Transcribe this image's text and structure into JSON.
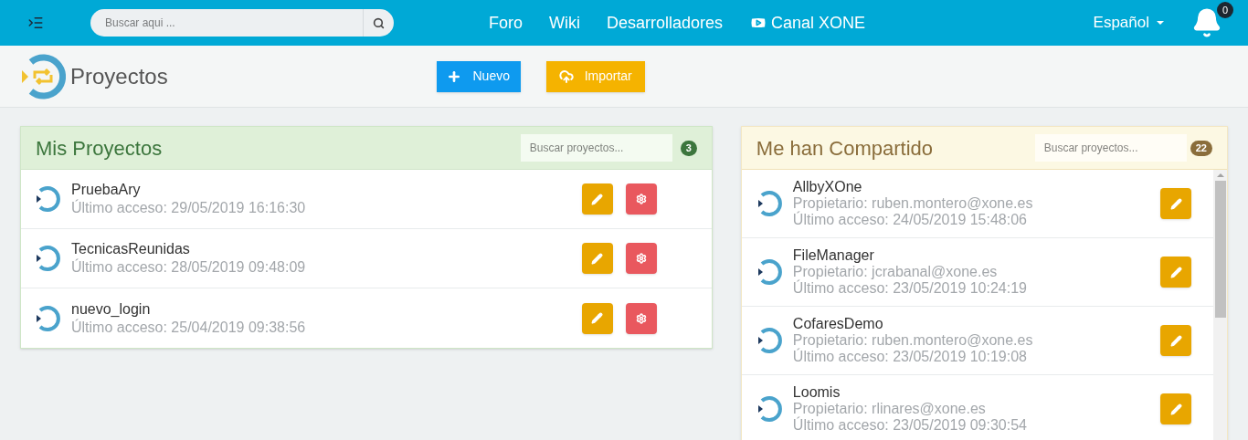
{
  "header": {
    "search": {
      "placeholder": "Buscar aqui ..."
    },
    "nav": [
      {
        "label": "Foro",
        "kind": "text"
      },
      {
        "label": "Wiki",
        "kind": "text"
      },
      {
        "label": "Desarrolladores",
        "kind": "text"
      },
      {
        "label": "Canal XONE",
        "kind": "video"
      }
    ],
    "language": "Español",
    "notifications": "0"
  },
  "page": {
    "title": "Proyectos",
    "actions": [
      {
        "label": "Nuevo",
        "kind": "new"
      },
      {
        "label": "Importar",
        "kind": "import"
      }
    ]
  },
  "my_projects": {
    "title": "Mis Proyectos",
    "search": {
      "placeholder": "Buscar proyectos..."
    },
    "count": "3",
    "items": [
      {
        "name": "PruebaAry",
        "access": "Último acceso: 29/05/2019 16:16:30"
      },
      {
        "name": "TecnicasReunidas",
        "access": "Último acceso: 28/05/2019 09:48:09"
      },
      {
        "name": "nuevo_login",
        "access": "Último acceso: 25/04/2019 09:38:56"
      }
    ]
  },
  "shared": {
    "title": "Me han Compartido",
    "search": {
      "placeholder": "Buscar proyectos..."
    },
    "count": "22",
    "items": [
      {
        "name": "AllbyXOne",
        "owner": "Propietario: ruben.montero@xone.es",
        "access": "Último acceso: 24/05/2019 15:48:06"
      },
      {
        "name": "FileManager",
        "owner": "Propietario: jcrabanal@xone.es",
        "access": "Último acceso: 23/05/2019 10:24:19"
      },
      {
        "name": "CofaresDemo",
        "owner": "Propietario: ruben.montero@xone.es",
        "access": "Último acceso: 23/05/2019 10:19:08"
      },
      {
        "name": "Loomis",
        "owner": "Propietario: rlinares@xone.es",
        "access": "Último acceso: 23/05/2019 09:30:54"
      }
    ]
  }
}
